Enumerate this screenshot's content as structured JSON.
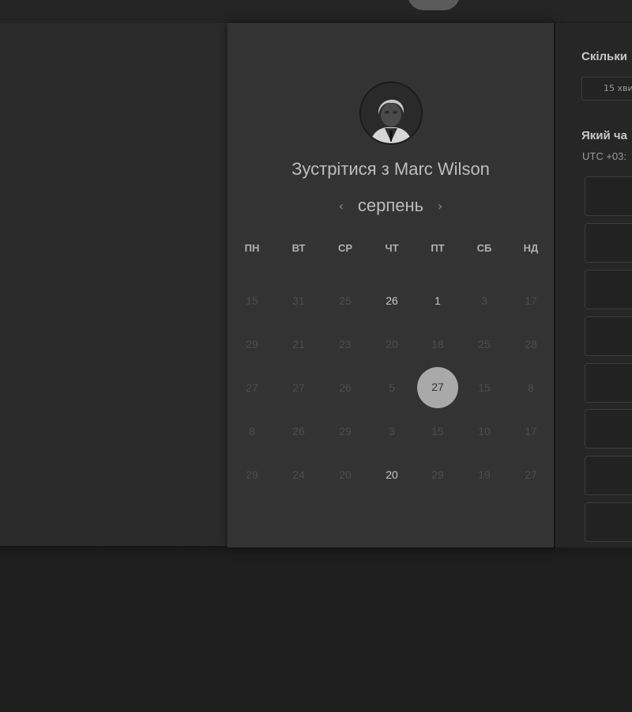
{
  "window": {
    "logo": "logo-icon"
  },
  "card": {
    "title": "Зустрітися з Marc Wilson",
    "avatar": "avatar-icon",
    "month": "серпень",
    "prev_icon": "‹",
    "next_icon": "›",
    "weekdays": [
      "ПН",
      "ВТ",
      "СР",
      "ЧТ",
      "ПТ",
      "СБ",
      "НД"
    ],
    "weeks": [
      [
        {
          "label": "15",
          "available": false
        },
        {
          "label": "31",
          "available": false
        },
        {
          "label": "25",
          "available": false
        },
        {
          "label": "26",
          "available": true
        },
        {
          "label": "1",
          "available": true
        },
        {
          "label": "3",
          "available": false
        },
        {
          "label": "17",
          "available": false
        }
      ],
      [
        {
          "label": "29",
          "available": false
        },
        {
          "label": "21",
          "available": false
        },
        {
          "label": "23",
          "available": false
        },
        {
          "label": "20",
          "available": false
        },
        {
          "label": "18",
          "available": false
        },
        {
          "label": "25",
          "available": false
        },
        {
          "label": "28",
          "available": false
        }
      ],
      [
        {
          "label": "27",
          "available": false
        },
        {
          "label": "27",
          "available": false
        },
        {
          "label": "26",
          "available": false
        },
        {
          "label": "5",
          "available": false
        },
        {
          "label": "27",
          "available": true,
          "selected": true
        },
        {
          "label": "15",
          "available": false
        },
        {
          "label": "8",
          "available": false
        }
      ],
      [
        {
          "label": "8",
          "available": false
        },
        {
          "label": "26",
          "available": false
        },
        {
          "label": "29",
          "available": false
        },
        {
          "label": "3",
          "available": false
        },
        {
          "label": "15",
          "available": false
        },
        {
          "label": "10",
          "available": false
        },
        {
          "label": "17",
          "available": false
        }
      ],
      [
        {
          "label": "29",
          "available": false
        },
        {
          "label": "24",
          "available": false
        },
        {
          "label": "20",
          "available": false
        },
        {
          "label": "20",
          "available": true
        },
        {
          "label": "29",
          "available": false
        },
        {
          "label": "19",
          "available": false
        },
        {
          "label": "27",
          "available": false
        }
      ]
    ]
  },
  "scheduler": {
    "duration_heading": "Скільки",
    "duration_value": "15 хви",
    "time_heading": "Який ча",
    "timezone": "UTC +03:",
    "slots": [
      "",
      "",
      "",
      "",
      "",
      "",
      "",
      ""
    ]
  },
  "colors": {
    "background": "#1e1e1e",
    "card": "#333333",
    "selected_day": "#a9a9a9"
  }
}
